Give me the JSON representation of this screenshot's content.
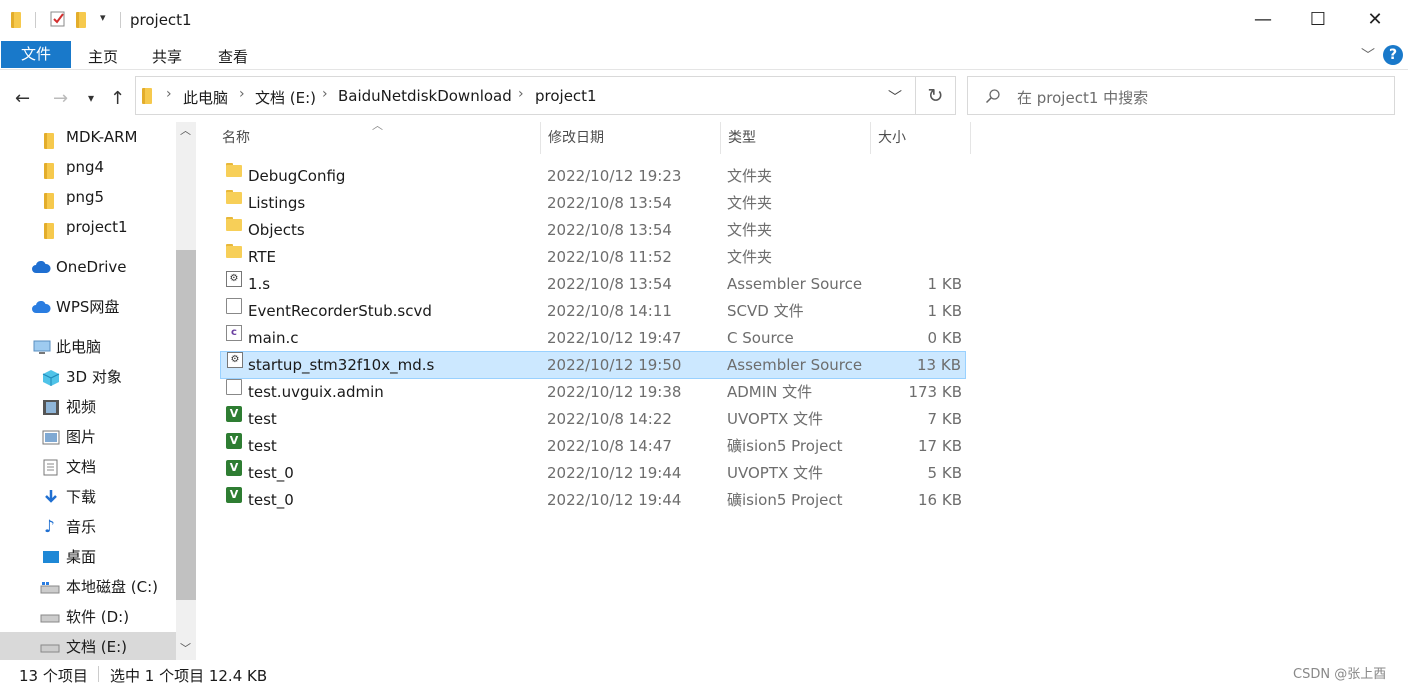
{
  "window": {
    "title": "project1",
    "minimize": "—",
    "maximize": "☐",
    "close": "✕"
  },
  "ribbon": {
    "tabs": [
      "文件",
      "主页",
      "共享",
      "查看"
    ],
    "help": "?"
  },
  "address": {
    "crumbs": [
      "此电脑",
      "文档 (E:)",
      "BaiduNetdiskDownload",
      "project1"
    ]
  },
  "search": {
    "placeholder": "在 project1 中搜索"
  },
  "sidebar": {
    "items": [
      {
        "label": "MDK-ARM",
        "icon": "folder-icon"
      },
      {
        "label": "png4",
        "icon": "folder-icon"
      },
      {
        "label": "png5",
        "icon": "folder-icon"
      },
      {
        "label": "project1",
        "icon": "folder-icon"
      },
      {
        "label": "OneDrive",
        "icon": "cloud-icon"
      },
      {
        "label": "WPS网盘",
        "icon": "cloud-icon"
      },
      {
        "label": "此电脑",
        "icon": "computer-icon"
      },
      {
        "label": "3D 对象",
        "icon": "3d-objects-icon"
      },
      {
        "label": "视频",
        "icon": "video-icon"
      },
      {
        "label": "图片",
        "icon": "pictures-icon"
      },
      {
        "label": "文档",
        "icon": "documents-icon"
      },
      {
        "label": "下载",
        "icon": "download-icon"
      },
      {
        "label": "音乐",
        "icon": "music-icon"
      },
      {
        "label": "桌面",
        "icon": "desktop-icon"
      },
      {
        "label": "本地磁盘 (C:)",
        "icon": "drive-icon"
      },
      {
        "label": "软件 (D:)",
        "icon": "drive-icon"
      },
      {
        "label": "文档 (E:)",
        "icon": "drive-icon"
      }
    ]
  },
  "columns": {
    "name": "名称",
    "date": "修改日期",
    "type": "类型",
    "size": "大小"
  },
  "files": [
    {
      "name": "DebugConfig",
      "date": "2022/10/12 19:23",
      "type": "文件夹",
      "size": "",
      "icon": "folder-icon"
    },
    {
      "name": "Listings",
      "date": "2022/10/8 13:54",
      "type": "文件夹",
      "size": "",
      "icon": "folder-icon"
    },
    {
      "name": "Objects",
      "date": "2022/10/8 13:54",
      "type": "文件夹",
      "size": "",
      "icon": "folder-icon"
    },
    {
      "name": "RTE",
      "date": "2022/10/8 11:52",
      "type": "文件夹",
      "size": "",
      "icon": "folder-icon"
    },
    {
      "name": "1.s",
      "date": "2022/10/8 13:54",
      "type": "Assembler Source",
      "size": "1 KB",
      "icon": "assembler-icon"
    },
    {
      "name": "EventRecorderStub.scvd",
      "date": "2022/10/8 14:11",
      "type": "SCVD 文件",
      "size": "1 KB",
      "icon": "file-icon"
    },
    {
      "name": "main.c",
      "date": "2022/10/12 19:47",
      "type": "C Source",
      "size": "0 KB",
      "icon": "c-source-icon"
    },
    {
      "name": "startup_stm32f10x_md.s",
      "date": "2022/10/12 19:50",
      "type": "Assembler Source",
      "size": "13 KB",
      "icon": "assembler-icon",
      "selected": true
    },
    {
      "name": "test.uvguix.admin",
      "date": "2022/10/12 19:38",
      "type": "ADMIN 文件",
      "size": "173 KB",
      "icon": "file-icon"
    },
    {
      "name": "test",
      "date": "2022/10/8 14:22",
      "type": "UVOPTX 文件",
      "size": "7 KB",
      "icon": "uvision-icon"
    },
    {
      "name": "test",
      "date": "2022/10/8 14:47",
      "type": "礦ision5 Project",
      "size": "17 KB",
      "icon": "uvision-icon"
    },
    {
      "name": "test_0",
      "date": "2022/10/12 19:44",
      "type": "UVOPTX 文件",
      "size": "5 KB",
      "icon": "uvision-icon"
    },
    {
      "name": "test_0",
      "date": "2022/10/12 19:44",
      "type": "礦ision5 Project",
      "size": "16 KB",
      "icon": "uvision-icon"
    }
  ],
  "status": {
    "count": "13 个项目",
    "selection": "选中 1 个项目 12.4 KB",
    "watermark": "CSDN @张上酉"
  }
}
